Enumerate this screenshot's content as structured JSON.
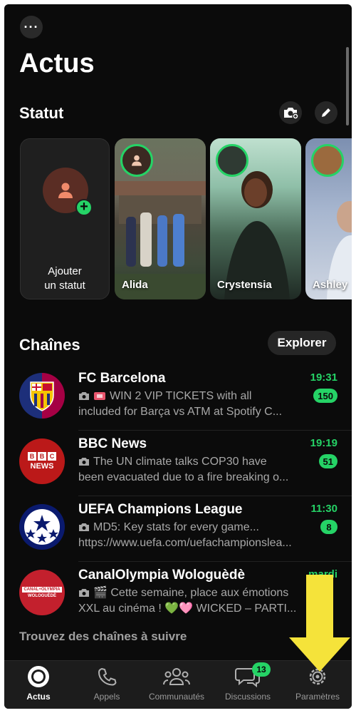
{
  "header": {
    "title": "Actus",
    "more_icon": "ellipsis-icon"
  },
  "status_section": {
    "title": "Statut",
    "camera_icon": "camera-add-icon",
    "edit_icon": "pencil-icon",
    "add_status_label_line1": "Ajouter",
    "add_status_label_line2": "un statut",
    "stories": [
      {
        "name": "Alida"
      },
      {
        "name": "Crystensia"
      },
      {
        "name": "Ashley"
      }
    ]
  },
  "channels_section": {
    "title": "Chaînes",
    "explore_label": "Explorer",
    "channels": [
      {
        "name": "FC Barcelona",
        "time": "19:31",
        "unread": "150",
        "preview_line1": "WIN 2 VIP TICKETS with all",
        "preview_line2": "included for Barça vs ATM at Spotify C...",
        "avatar_color": "#a50044"
      },
      {
        "name": "BBC News",
        "time": "19:19",
        "unread": "51",
        "preview_line1": "The UN climate talks COP30 have",
        "preview_line2": "been evacuated due to a fire breaking o...",
        "avatar_color": "#bb1919"
      },
      {
        "name": "UEFA Champions League",
        "time": "11:30",
        "unread": "8",
        "preview_line1": "MD5: Key stats for every game...",
        "preview_line2": "https://www.uefa.com/uefachampionslea...",
        "avatar_color": "#0a1a6e"
      },
      {
        "name": "CanalOlympia Wologuèdè",
        "time": "mardi",
        "preview_line1": "🎬 Cette semaine, place aux émotions",
        "preview_line2": "XXL au cinéma ! 💚🩷 WICKED – PARTI...",
        "avatar_color": "#c3202d",
        "avatar_text_line1": "CANAL+OLYMPIA",
        "avatar_text_line2": "WOLOGUÈDÈ"
      }
    ],
    "find_more_label": "Trouvez des chaînes à suivre"
  },
  "bbc_logo_text": "BBC",
  "bbc_logo_sub": "NEWS",
  "fcb_logo_text": "FCB",
  "tabbar": {
    "tabs": [
      {
        "label": "Actus",
        "icon": "updates-icon",
        "active": true
      },
      {
        "label": "Appels",
        "icon": "phone-icon"
      },
      {
        "label": "Communautés",
        "icon": "communities-icon"
      },
      {
        "label": "Discussions",
        "icon": "chats-icon",
        "badge": "13"
      },
      {
        "label": "Paramètres",
        "icon": "settings-gear-icon"
      }
    ]
  },
  "colors": {
    "background": "#0b0b0b",
    "accent_green": "#25d366",
    "annotation_arrow": "#f5e33a"
  }
}
